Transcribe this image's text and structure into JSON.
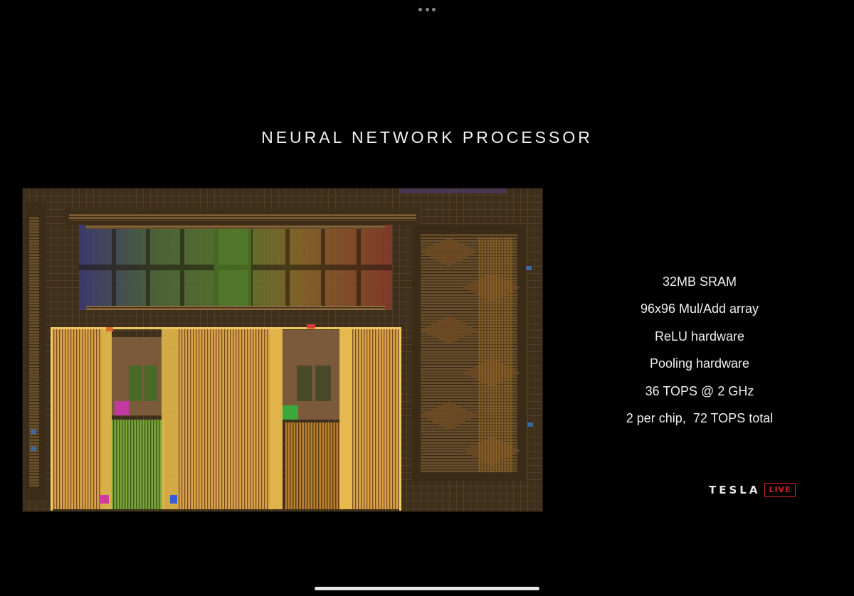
{
  "window_menu": {
    "icon": "more-dots-icon"
  },
  "slide": {
    "title": "NEURAL NETWORK PROCESSOR",
    "image": {
      "icon": "chip-die-photo"
    },
    "specs": [
      "32MB SRAM",
      "96x96 Mul/Add array",
      "ReLU hardware",
      "Pooling hardware",
      "36 TOPS @ 2 GHz",
      "2 per chip,  72 TOPS total"
    ],
    "logo": {
      "wordmark": "TESLA",
      "badge": "LIVE",
      "badge_color": "#c8222a"
    }
  },
  "home_indicator": {
    "icon": "home-indicator-bar"
  }
}
